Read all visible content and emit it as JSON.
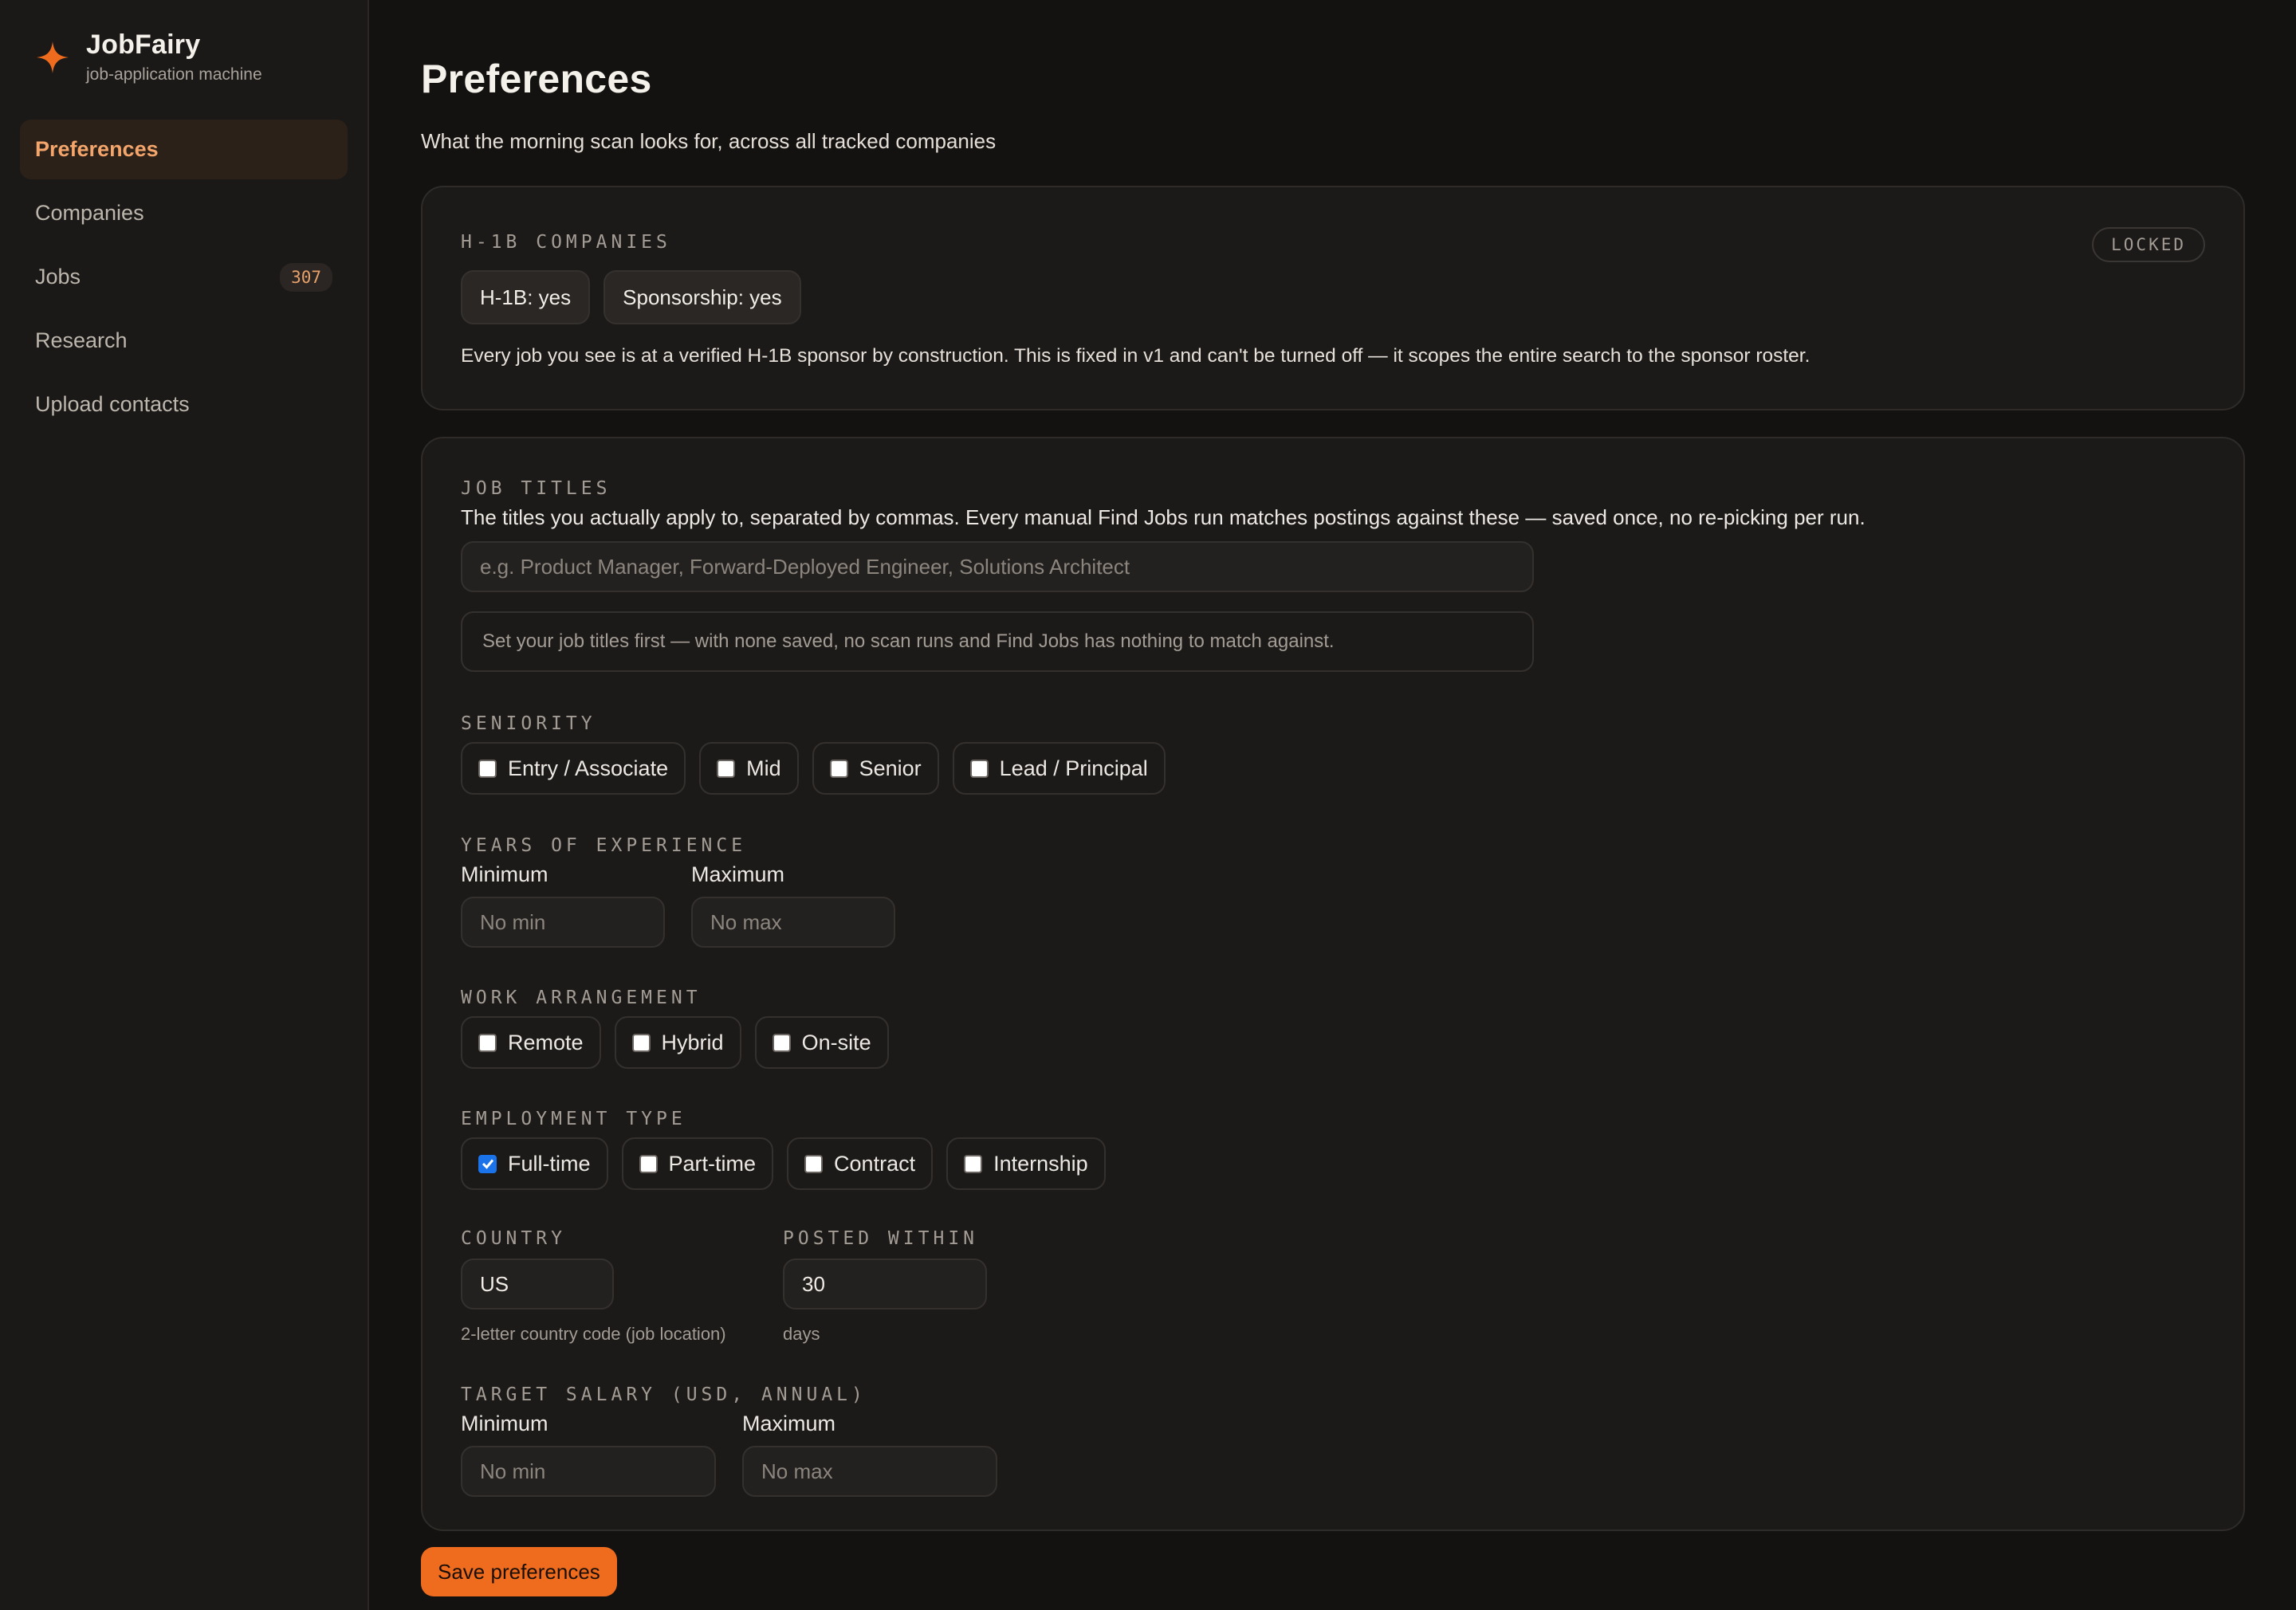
{
  "brand": {
    "name": "JobFairy",
    "subtitle": "job-application machine",
    "accent": "#ef6c1e"
  },
  "sidebar": {
    "items": [
      {
        "label": "Preferences",
        "active": true
      },
      {
        "label": "Companies"
      },
      {
        "label": "Jobs",
        "badge": "307"
      },
      {
        "label": "Research"
      },
      {
        "label": "Upload contacts"
      }
    ]
  },
  "page": {
    "title": "Preferences",
    "subtitle": "What the morning scan looks for, across all tracked companies"
  },
  "h1b": {
    "label": "H-1B COMPANIES",
    "locked": "LOCKED",
    "chips": [
      "H-1B: yes",
      "Sponsorship: yes"
    ],
    "note": "Every job you see is at a verified H-1B sponsor by construction. This is fixed in v1 and can't be turned off — it scopes the entire search to the sponsor roster."
  },
  "job_titles": {
    "label": "JOB TITLES",
    "description": "The titles you actually apply to, separated by commas. Every manual Find Jobs run matches postings against these — saved once, no re-picking per run.",
    "placeholder": "e.g. Product Manager, Forward-Deployed Engineer, Solutions Architect",
    "notice": "Set your job titles first — with none saved, no scan runs and Find Jobs has nothing to match against."
  },
  "seniority": {
    "label": "SENIORITY",
    "options": [
      {
        "label": "Entry / Associate",
        "checked": false
      },
      {
        "label": "Mid",
        "checked": false
      },
      {
        "label": "Senior",
        "checked": false
      },
      {
        "label": "Lead / Principal",
        "checked": false
      }
    ]
  },
  "experience": {
    "label": "YEARS OF EXPERIENCE",
    "min_label": "Minimum",
    "min_placeholder": "No min",
    "max_label": "Maximum",
    "max_placeholder": "No max"
  },
  "work_arrangement": {
    "label": "WORK ARRANGEMENT",
    "options": [
      {
        "label": "Remote",
        "checked": false
      },
      {
        "label": "Hybrid",
        "checked": false
      },
      {
        "label": "On-site",
        "checked": false
      }
    ]
  },
  "employment_type": {
    "label": "EMPLOYMENT TYPE",
    "options": [
      {
        "label": "Full-time",
        "checked": true
      },
      {
        "label": "Part-time",
        "checked": false
      },
      {
        "label": "Contract",
        "checked": false
      },
      {
        "label": "Internship",
        "checked": false
      }
    ]
  },
  "country": {
    "label": "COUNTRY",
    "value": "US",
    "hint": "2-letter country code (job location)"
  },
  "posted_within": {
    "label": "POSTED WITHIN",
    "value": "30",
    "hint": "days"
  },
  "salary": {
    "label": "TARGET SALARY (USD, ANNUAL)",
    "min_label": "Minimum",
    "min_placeholder": "No min",
    "max_label": "Maximum",
    "max_placeholder": "No max"
  },
  "save_label": "Save preferences"
}
